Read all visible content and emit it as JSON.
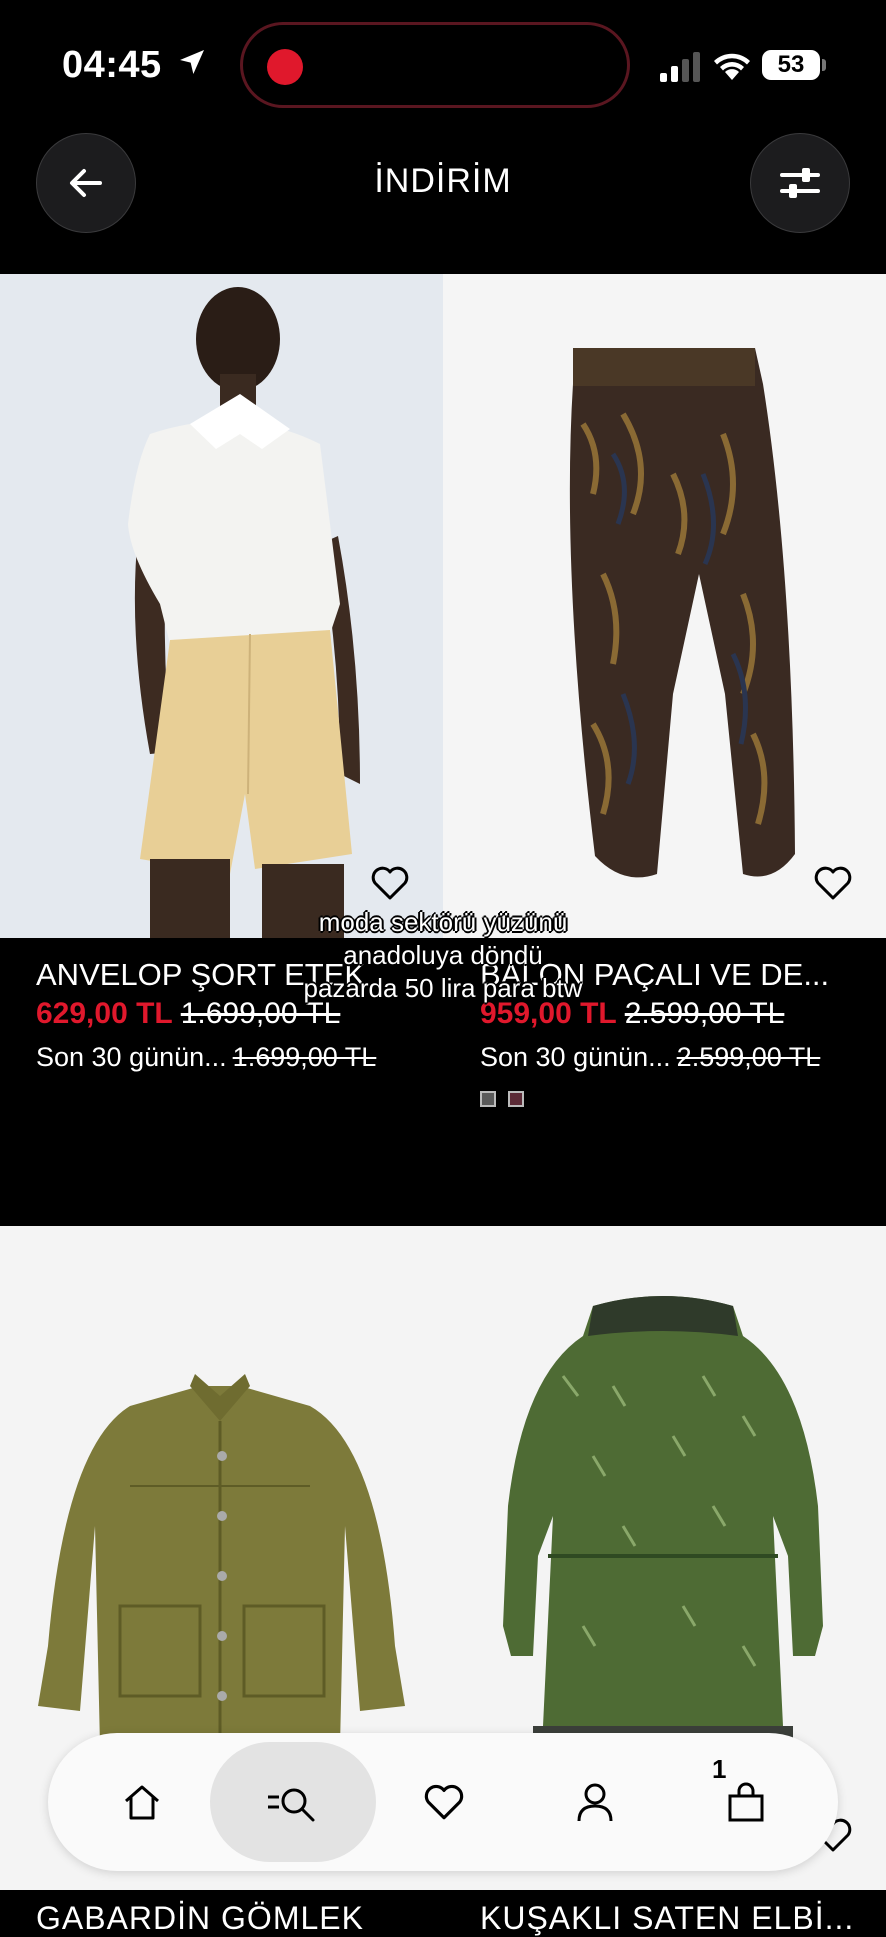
{
  "status_bar": {
    "time": "04:45",
    "battery": "53"
  },
  "header": {
    "title": "İNDİRİM"
  },
  "caption": {
    "line1": "moda sektörü yüzünü",
    "line2": "anadoluya döndü",
    "line3": "pazarda 50 lira para btw"
  },
  "products": [
    {
      "name": "ANVELOP ŞORT ETEK",
      "sale_price": "629,00 TL",
      "old_price": "1.699,00 TL",
      "history_label": "Son 30 günün...",
      "history_price": "1.699,00 TL"
    },
    {
      "name": "BALON PAÇALI VE DE...",
      "sale_price": "959,00 TL",
      "old_price": "2.599,00 TL",
      "history_label": "Son 30 günün...",
      "history_price": "2.599,00 TL",
      "swatches": [
        "#5a5a5a",
        "#5b2a36"
      ]
    },
    {
      "name": "GABARDİN GÖMLEK"
    },
    {
      "name": "KUŞAKLI SATEN ELBİ..."
    }
  ],
  "nav": {
    "items": [
      "home-icon",
      "search-icon",
      "heart-icon",
      "profile-icon",
      "cart-icon"
    ],
    "active": "search-icon",
    "cart_count": "1"
  },
  "colors": {
    "sale": "#e0182c",
    "background": "#000000"
  }
}
